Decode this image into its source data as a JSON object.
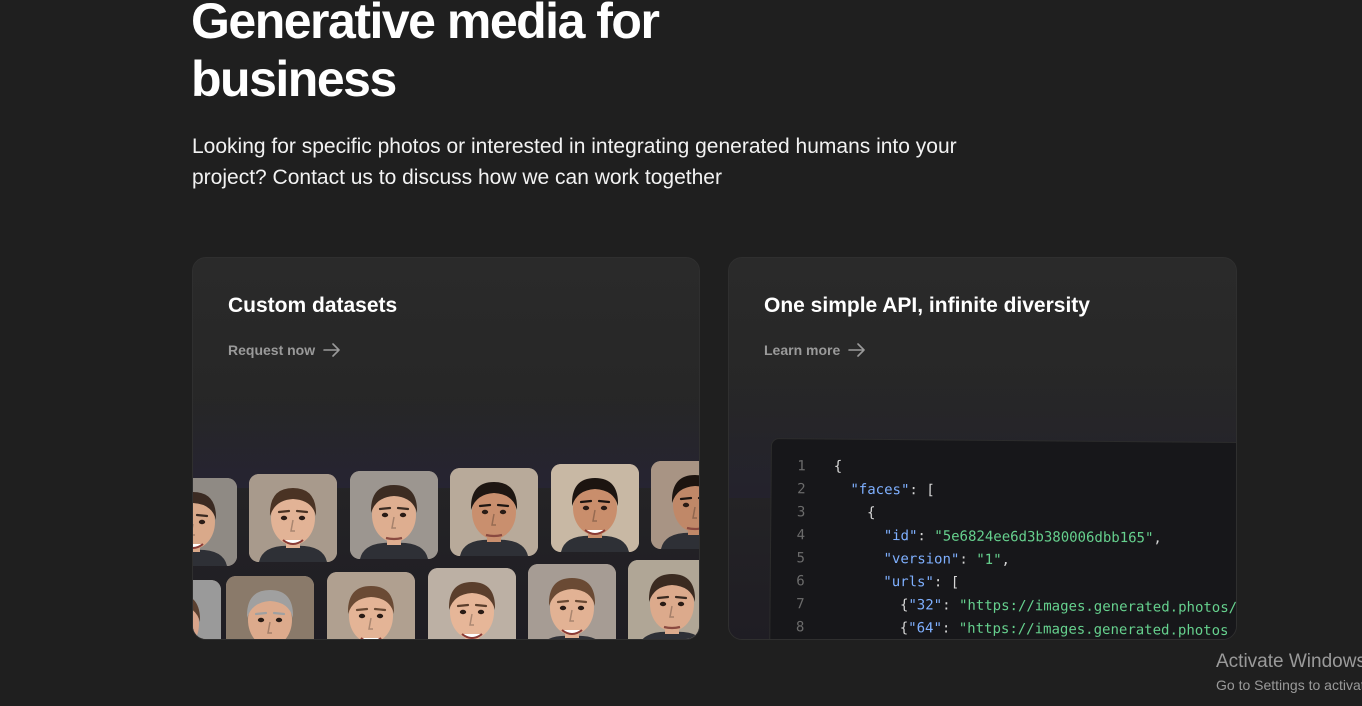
{
  "hero": {
    "title": "Generative media for business",
    "subtitle": "Looking for specific photos or interested in integrating generated humans into your project? Contact us to discuss how we can work together"
  },
  "cards": [
    {
      "title": "Custom datasets",
      "link": "Request now",
      "icon": "arrow-right-icon"
    },
    {
      "title": "One simple API, infinite diversity",
      "link": "Learn more",
      "icon": "arrow-right-icon"
    }
  ],
  "code": {
    "lines": [
      {
        "n": "1",
        "segments": [
          {
            "t": "{",
            "k": "pun"
          }
        ]
      },
      {
        "n": "2",
        "segments": [
          {
            "t": "  ",
            "k": "pun"
          },
          {
            "t": "\"faces\"",
            "k": "key"
          },
          {
            "t": ": [",
            "k": "pun"
          }
        ]
      },
      {
        "n": "3",
        "segments": [
          {
            "t": "    {",
            "k": "pun"
          }
        ]
      },
      {
        "n": "4",
        "segments": [
          {
            "t": "      ",
            "k": "pun"
          },
          {
            "t": "\"id\"",
            "k": "key"
          },
          {
            "t": ": ",
            "k": "pun"
          },
          {
            "t": "\"5e6824ee6d3b380006dbb165\"",
            "k": "str"
          },
          {
            "t": ",",
            "k": "pun"
          }
        ]
      },
      {
        "n": "5",
        "segments": [
          {
            "t": "      ",
            "k": "pun"
          },
          {
            "t": "\"version\"",
            "k": "key"
          },
          {
            "t": ": ",
            "k": "pun"
          },
          {
            "t": "\"1\"",
            "k": "str"
          },
          {
            "t": ",",
            "k": "pun"
          }
        ]
      },
      {
        "n": "6",
        "segments": [
          {
            "t": "      ",
            "k": "pun"
          },
          {
            "t": "\"urls\"",
            "k": "key"
          },
          {
            "t": ": [",
            "k": "pun"
          }
        ]
      },
      {
        "n": "7",
        "segments": [
          {
            "t": "        {",
            "k": "pun"
          },
          {
            "t": "\"32\"",
            "k": "key"
          },
          {
            "t": ": ",
            "k": "pun"
          },
          {
            "t": "\"https://images.generated.photos/",
            "k": "str"
          }
        ]
      },
      {
        "n": "8",
        "segments": [
          {
            "t": "        {",
            "k": "pun"
          },
          {
            "t": "\"64\"",
            "k": "key"
          },
          {
            "t": ": ",
            "k": "pun"
          },
          {
            "t": "\"https://images.generated.photos",
            "k": "str"
          }
        ]
      }
    ]
  },
  "faces": [
    {
      "skin": "#d9a98a",
      "hair": "#3a2a22",
      "bg": "#8f8a84",
      "smile": true
    },
    {
      "skin": "#e2b396",
      "hair": "#4a3324",
      "bg": "#a89a8c",
      "smile": true
    },
    {
      "skin": "#deae90",
      "hair": "#3c2c22",
      "bg": "#9c9690",
      "smile": false
    },
    {
      "skin": "#c98f6e",
      "hair": "#1e1612",
      "bg": "#b8aa9a",
      "smile": false
    },
    {
      "skin": "#c98e6c",
      "hair": "#1c1410",
      "bg": "#c8b8a4",
      "smile": true
    },
    {
      "skin": "#c08868",
      "hair": "#1c1410",
      "bg": "#a89484",
      "smile": false
    },
    {
      "skin": "#d8a48a",
      "hair": "#5a4030",
      "bg": "#9a9a9a",
      "smile": true
    },
    {
      "skin": "#dcaa8c",
      "hair": "#a0a0a0",
      "bg": "#8a7a6a",
      "smile": true
    },
    {
      "skin": "#e4b496",
      "hair": "#6a4a34",
      "bg": "#b0a090",
      "smile": true
    },
    {
      "skin": "#e6b698",
      "hair": "#5a3e2c",
      "bg": "#bcb0a4",
      "smile": true
    },
    {
      "skin": "#e2b294",
      "hair": "#6a4a34",
      "bg": "#a69c94",
      "smile": true
    },
    {
      "skin": "#dcaa8c",
      "hair": "#3a2a20",
      "bg": "#b0a696",
      "smile": false
    }
  ],
  "watermark": {
    "title": "Activate Windows",
    "subtitle": "Go to Settings to activate Windows."
  }
}
